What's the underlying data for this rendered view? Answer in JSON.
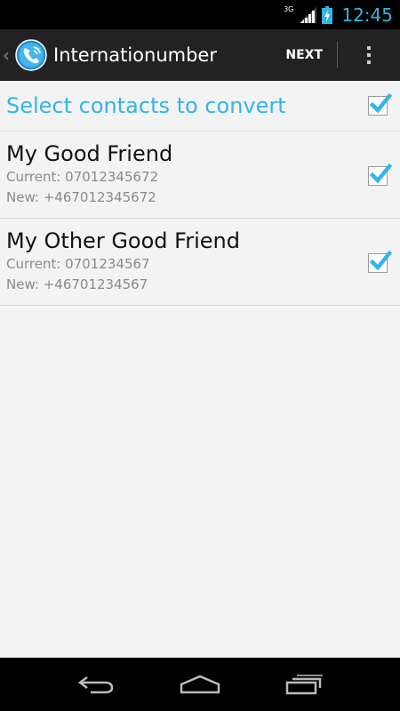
{
  "status_bar": {
    "network_type": "3G",
    "time": "12:45",
    "accent_color": "#33b5e5"
  },
  "action_bar": {
    "up_indicator": "‹",
    "app_icon": "phone-call-icon",
    "title": "Internationumber",
    "next_label": "NEXT",
    "overflow_icon": "overflow-menu-icon"
  },
  "list": {
    "header_title": "Select contacts to convert",
    "select_all_checked": true,
    "contacts": [
      {
        "name": "My Good Friend",
        "current": "Current: 07012345672",
        "new": "New: +467012345672",
        "checked": true
      },
      {
        "name": "My Other Good Friend",
        "current": "Current: 0701234567",
        "new": "New: +46701234567",
        "checked": true
      }
    ]
  },
  "nav_bar": {
    "back_icon": "back-icon",
    "home_icon": "home-icon",
    "recents_icon": "recents-icon"
  }
}
